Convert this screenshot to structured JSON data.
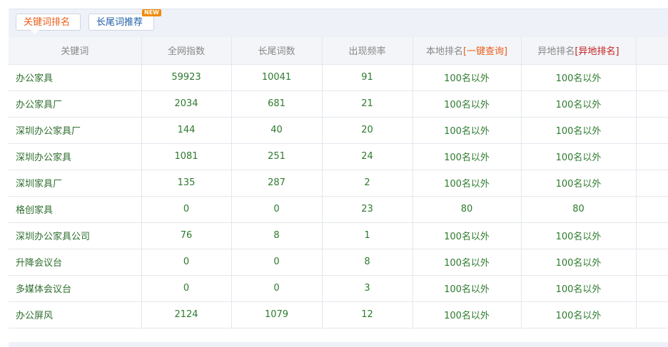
{
  "tabs": {
    "keyword_rank": "关键词排名",
    "longtail": "长尾词推荐",
    "new_badge": "NEW"
  },
  "headers": {
    "keyword": "关键词",
    "index": "全网指数",
    "longtail_count": "长尾词数",
    "frequency": "出现频率",
    "local_rank": "本地排名",
    "local_rank_link": "[一键查询]",
    "remote_rank": "异地排名",
    "remote_rank_link": "[异地排名]"
  },
  "rows": [
    {
      "keyword": "办公家具",
      "index": "59923",
      "longtail": "10041",
      "freq": "91",
      "local": "100名以外",
      "remote": "100名以外"
    },
    {
      "keyword": "办公家具厂",
      "index": "2034",
      "longtail": "681",
      "freq": "21",
      "local": "100名以外",
      "remote": "100名以外"
    },
    {
      "keyword": "深圳办公家具厂",
      "index": "144",
      "longtail": "40",
      "freq": "20",
      "local": "100名以外",
      "remote": "100名以外"
    },
    {
      "keyword": "深圳办公家具",
      "index": "1081",
      "longtail": "251",
      "freq": "24",
      "local": "100名以外",
      "remote": "100名以外"
    },
    {
      "keyword": "深圳家具厂",
      "index": "135",
      "longtail": "287",
      "freq": "2",
      "local": "100名以外",
      "remote": "100名以外"
    },
    {
      "keyword": "格创家具",
      "index": "0",
      "longtail": "0",
      "freq": "23",
      "local": "80",
      "remote": "80"
    },
    {
      "keyword": "深圳办公家具公司",
      "index": "76",
      "longtail": "8",
      "freq": "1",
      "local": "100名以外",
      "remote": "100名以外"
    },
    {
      "keyword": "升降会议台",
      "index": "0",
      "longtail": "0",
      "freq": "8",
      "local": "100名以外",
      "remote": "100名以外"
    },
    {
      "keyword": "多媒体会议台",
      "index": "0",
      "longtail": "0",
      "freq": "3",
      "local": "100名以外",
      "remote": "100名以外"
    },
    {
      "keyword": "办公屏风",
      "index": "2124",
      "longtail": "1079",
      "freq": "12",
      "local": "100名以外",
      "remote": "100名以外"
    }
  ]
}
